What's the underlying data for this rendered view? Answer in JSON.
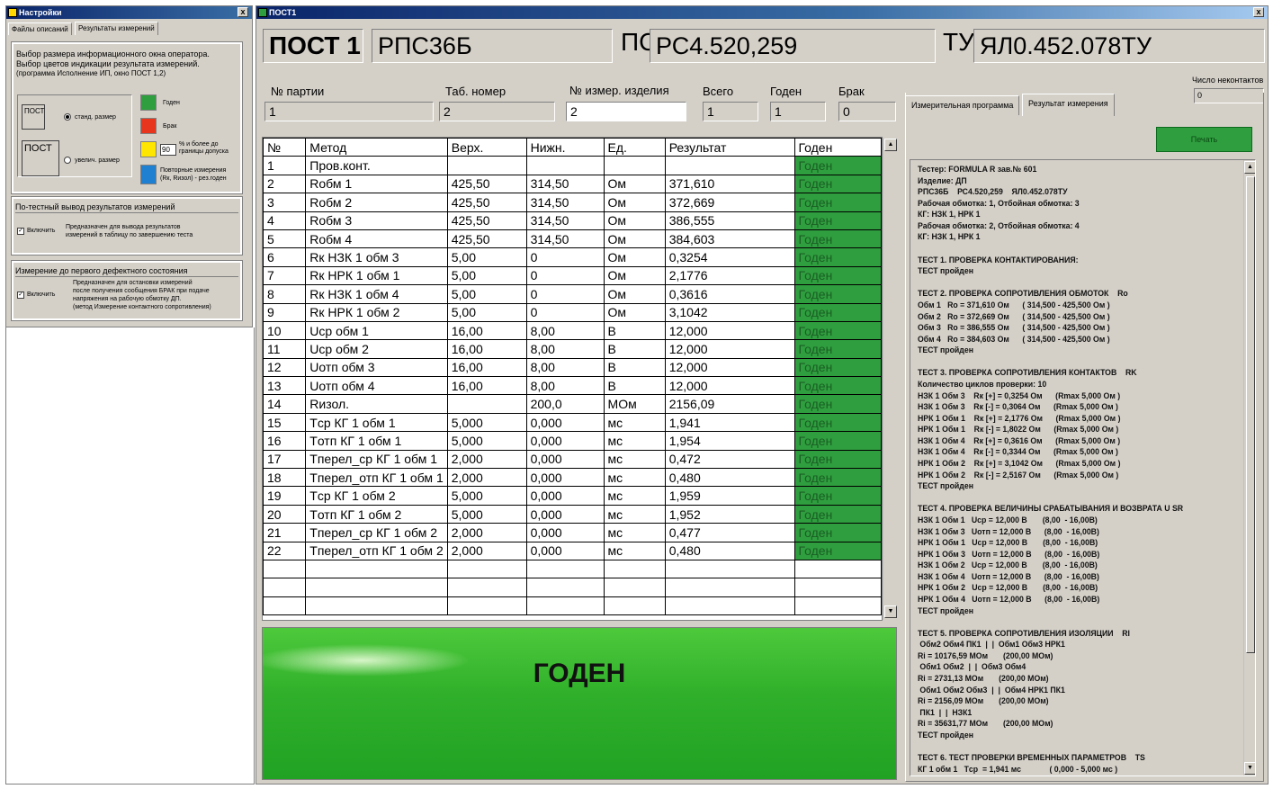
{
  "settings_window": {
    "title": "Настройки",
    "close": "x",
    "tabs": [
      "Файлы описаний",
      "Результаты измерений"
    ],
    "group1": {
      "line1": "Выбор размера информационного окна оператора.",
      "line2": "Выбор цветов индикации результата измерений.",
      "line3": "(программа Исполнение ИП, окно ПОСТ 1,2)",
      "small_preview": "ПОСТ",
      "big_preview": "ПОСТ",
      "radio_standard": "станд. размер",
      "radio_enlarged": "увелич. размер",
      "colors": [
        {
          "label": "Годен",
          "color": "#2f9e3f"
        },
        {
          "label": "Брак",
          "color": "#e8351e"
        },
        {
          "label_line1": "% и более до",
          "label_line2": "границы допуска",
          "color": "#ffe600",
          "value": "90"
        },
        {
          "label_line1": "Повторные измерения",
          "label_line2": "(Rк, Rизол) - рез.годен",
          "color": "#1f7fd0"
        }
      ]
    },
    "group2": {
      "title": "По-тестный вывод результатов измерений",
      "checkbox": "Включить",
      "desc1": "Предназначен для вывода результатов",
      "desc2": "измерений в таблицу по завершению теста"
    },
    "group3": {
      "title": "Измерение до первого дефектного состояния",
      "checkbox": "Включить",
      "desc1": "Предназначен для остановки измерений",
      "desc2": "после получения сообщения БРАК при подаче",
      "desc3": "напряжения на рабочую обмотку ДП.",
      "desc4": "(метод Измерение контактного сопротивления)"
    }
  },
  "post_window": {
    "title": "ПОСТ1",
    "close": "x",
    "post_label": "ПОСТ 1",
    "product": "РПС36Б",
    "ps_label": "ПС",
    "ps_value": "РС4.520,259",
    "tu_label": "ТУ",
    "tu_value": "ЯЛ0.452.078ТУ",
    "fields": [
      {
        "label": "№ партии",
        "value": "1"
      },
      {
        "label": "Таб. номер",
        "value": "2"
      },
      {
        "label": "№ измер. изделия",
        "value": "2"
      },
      {
        "label": "Всего",
        "value": "1"
      },
      {
        "label": "Годен",
        "value": "1"
      },
      {
        "label": "Брак",
        "value": "0"
      }
    ],
    "noncontact_label": "Число неконтактов",
    "noncontact_value": "0",
    "tabs": [
      "Измерительная программа",
      "Результат измерения"
    ],
    "print_button": "Печать",
    "table": {
      "headers": [
        "№",
        "Метод",
        "Верх.",
        "Нижн.",
        "Ед.",
        "Результат",
        "Годен"
      ],
      "rows": [
        [
          "1",
          "Пров.конт.",
          "",
          "",
          "",
          "",
          "Годен"
        ],
        [
          "2",
          "Rобм 1",
          "425,50",
          "314,50",
          "Ом",
          "371,610",
          "Годен"
        ],
        [
          "3",
          "Rобм 2",
          "425,50",
          "314,50",
          "Ом",
          "372,669",
          "Годен"
        ],
        [
          "4",
          "Rобм 3",
          "425,50",
          "314,50",
          "Ом",
          "386,555",
          "Годен"
        ],
        [
          "5",
          "Rобм 4",
          "425,50",
          "314,50",
          "Ом",
          "384,603",
          "Годен"
        ],
        [
          "6",
          "Rк НЗК 1 обм 3",
          "5,00",
          "0",
          "Ом",
          "0,3254",
          "Годен"
        ],
        [
          "7",
          "Rк НРК 1 обм 1",
          "5,00",
          "0",
          "Ом",
          "2,1776",
          "Годен"
        ],
        [
          "8",
          "Rк НЗК 1 обм 4",
          "5,00",
          "0",
          "Ом",
          "0,3616",
          "Годен"
        ],
        [
          "9",
          "Rк НРК 1 обм 2",
          "5,00",
          "0",
          "Ом",
          "3,1042",
          "Годен"
        ],
        [
          "10",
          "Uср обм 1",
          "16,00",
          "8,00",
          "В",
          "12,000",
          "Годен"
        ],
        [
          "11",
          "Uср обм 2",
          "16,00",
          "8,00",
          "В",
          "12,000",
          "Годен"
        ],
        [
          "12",
          "Uотп обм 3",
          "16,00",
          "8,00",
          "В",
          "12,000",
          "Годен"
        ],
        [
          "13",
          "Uотп обм 4",
          "16,00",
          "8,00",
          "В",
          "12,000",
          "Годен"
        ],
        [
          "14",
          "Rизол.",
          "",
          "200,0",
          "МОм",
          "2156,09",
          "Годен"
        ],
        [
          "15",
          "Tср КГ 1 обм 1",
          "5,000",
          "0,000",
          "мс",
          "1,941",
          "Годен"
        ],
        [
          "16",
          "Tотп КГ 1 обм 1",
          "5,000",
          "0,000",
          "мс",
          "1,954",
          "Годен"
        ],
        [
          "17",
          "Tперел_ср КГ 1 обм 1",
          "2,000",
          "0,000",
          "мс",
          "0,472",
          "Годен"
        ],
        [
          "18",
          "Tперел_отп КГ 1 обм 1",
          "2,000",
          "0,000",
          "мс",
          "0,480",
          "Годен"
        ],
        [
          "19",
          "Tср КГ 1 обм 2",
          "5,000",
          "0,000",
          "мс",
          "1,959",
          "Годен"
        ],
        [
          "20",
          "Tотп КГ 1 обм 2",
          "5,000",
          "0,000",
          "мс",
          "1,952",
          "Годен"
        ],
        [
          "21",
          "Tперел_ср КГ 1 обм 2",
          "2,000",
          "0,000",
          "мс",
          "0,477",
          "Годен"
        ],
        [
          "22",
          "Tперел_отп КГ 1 обм 2",
          "2,000",
          "0,000",
          "мс",
          "0,480",
          "Годен"
        ]
      ],
      "empty_rows": 3
    },
    "verdict": "ГОДЕН",
    "log": [
      "Тестер: FORMULA R зав.№ 601",
      "Изделие: ДП",
      "РПС36Б    РС4.520,259    ЯЛ0.452.078ТУ",
      "Рабочая обмотка: 1, Отбойная обмотка: 3",
      "КГ: НЗК 1, НРК 1",
      "Рабочая обмотка: 2, Отбойная обмотка: 4",
      "КГ: НЗК 1, НРК 1",
      "",
      "ТЕСТ 1. ПРОВЕРКА КОНТАКТИРОВАНИЯ:",
      "ТЕСТ пройден",
      "",
      "ТЕСТ 2. ПРОВЕРКА СОПРОТИВЛЕНИЯ ОБМОТОК    Ro",
      "Обм 1   Ro = 371,610 Ом      ( 314,500 - 425,500 Ом )",
      "Обм 2   Ro = 372,669 Ом      ( 314,500 - 425,500 Ом )",
      "Обм 3   Ro = 386,555 Ом      ( 314,500 - 425,500 Ом )",
      "Обм 4   Ro = 384,603 Ом      ( 314,500 - 425,500 Ом )",
      "ТЕСТ пройден",
      "",
      "ТЕСТ 3. ПРОВЕРКА СОПРОТИВЛЕНИЯ КОНТАКТОВ    RK",
      "Количество циклов проверки: 10",
      "НЗК 1 Обм 3    Rк [+] = 0,3254 Ом      (Rmax 5,000 Ом )",
      "НЗК 1 Обм 3    Rк [-] = 0,3064 Ом      (Rmax 5,000 Ом )",
      "НРК 1 Обм 1    Rк [+] = 2,1776 Ом      (Rmax 5,000 Ом )",
      "НРК 1 Обм 1    Rк [-] = 1,8022 Ом      (Rmax 5,000 Ом )",
      "НЗК 1 Обм 4    Rк [+] = 0,3616 Ом      (Rmax 5,000 Ом )",
      "НЗК 1 Обм 4    Rк [-] = 0,3344 Ом      (Rmax 5,000 Ом )",
      "НРК 1 Обм 2    Rк [+] = 3,1042 Ом      (Rmax 5,000 Ом )",
      "НРК 1 Обм 2    Rк [-] = 2,5167 Ом      (Rmax 5,000 Ом )",
      "ТЕСТ пройден",
      "",
      "ТЕСТ 4. ПРОВЕРКА ВЕЛИЧИНЫ СРАБАТЫВАНИЯ И ВОЗВРАТА U SR",
      "НЗК 1 Обм 1   Uср = 12,000 В       (8,00  - 16,00В)",
      "НЗК 1 Обм 3   Uотп = 12,000 В      (8,00  - 16,00В)",
      "НРК 1 Обм 1   Uср = 12,000 В       (8,00  - 16,00В)",
      "НРК 1 Обм 3   Uотп = 12,000 В      (8,00  - 16,00В)",
      "НЗК 1 Обм 2   Uср = 12,000 В       (8,00  - 16,00В)",
      "НЗК 1 Обм 4   Uотп = 12,000 В      (8,00  - 16,00В)",
      "НРК 1 Обм 2   Uср = 12,000 В       (8,00  - 16,00В)",
      "НРК 1 Обм 4   Uотп = 12,000 В      (8,00  - 16,00В)",
      "ТЕСТ пройден",
      "",
      "ТЕСТ 5. ПРОВЕРКА СОПРОТИВЛЕНИЯ ИЗОЛЯЦИИ    RI",
      " Обм2 Обм4 ПК1  |  |  Обм1 Обм3 НРК1",
      "Ri = 10176,59 МОм       (200,00 МОм)",
      " Обм1 Обм2  |  |  Обм3 Обм4",
      "Ri = 2731,13 МОм       (200,00 МОм)",
      " Обм1 Обм2 Обм3  |  |  Обм4 НРК1 ПК1",
      "Ri = 2156,09 МОм       (200,00 МОм)",
      " ПК1  |  |  НЗК1",
      "Ri = 35631,77 МОм       (200,00 МОм)",
      "ТЕСТ пройден",
      "",
      "ТЕСТ 6. ТЕСТ ПРОВЕРКИ ВРЕМЕННЫХ ПАРАМЕТРОВ    TS",
      "КГ 1 обм 1   Tср  = 1,941 мс             ( 0,000 - 5,000 мс )"
    ]
  }
}
